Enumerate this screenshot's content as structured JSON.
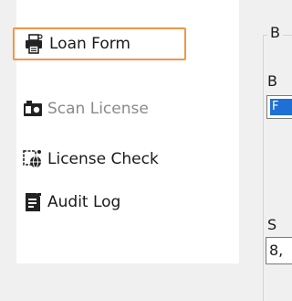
{
  "sidebar": {
    "items": [
      {
        "label": "Loan Form",
        "icon": "printer-form-icon",
        "state": "selected"
      },
      {
        "label": "Scan License",
        "icon": "id-card-scan-icon",
        "state": "disabled"
      },
      {
        "label": "License Check",
        "icon": "globe-document-check-icon",
        "state": "normal"
      },
      {
        "label": "Audit Log",
        "icon": "document-log-icon",
        "state": "normal"
      }
    ]
  },
  "right_panel": {
    "group_title": "B",
    "field1_label": "B",
    "field1_value": "F",
    "field2_label": "S",
    "field2_value": "8,"
  },
  "colors": {
    "selection_border": "#f0964a",
    "disabled_text": "#8a8a8a",
    "highlight_blue": "#1e6fd6"
  }
}
